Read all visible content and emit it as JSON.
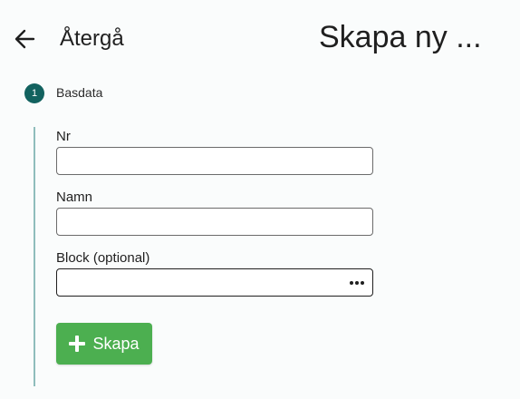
{
  "header": {
    "back_label": "Återgå",
    "title": "Skapa ny ..."
  },
  "stepper": {
    "steps": [
      {
        "number": "1",
        "label": "Basdata"
      }
    ],
    "accent_color": "#12625f"
  },
  "form": {
    "fields": [
      {
        "label": "Nr",
        "value": ""
      },
      {
        "label": "Namn",
        "value": ""
      },
      {
        "label": "Block (optional)",
        "value": ""
      }
    ],
    "more_icon": "more-horizontal-icon",
    "create_button": {
      "label": "Skapa",
      "icon": "plus-icon",
      "color": "#4caf50"
    }
  }
}
